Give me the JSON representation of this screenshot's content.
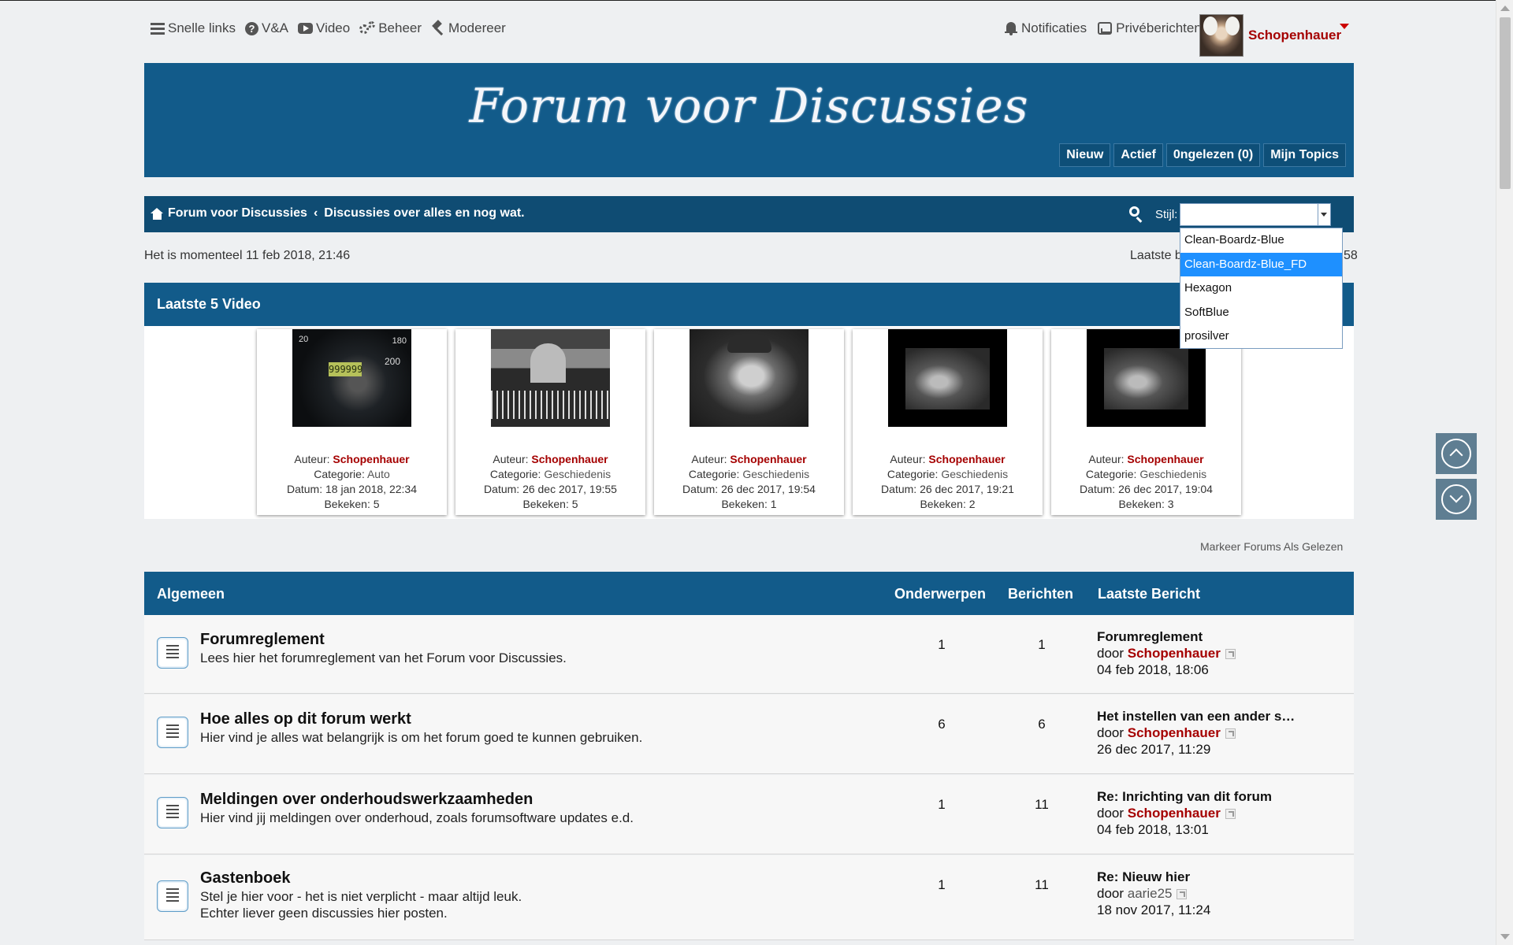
{
  "topnav": [
    {
      "label": "Snelle links",
      "icon": "bars-icon"
    },
    {
      "label": "V&A",
      "icon": "question-icon"
    },
    {
      "label": "Video",
      "icon": "youtube-icon"
    },
    {
      "label": "Beheer",
      "icon": "gears-icon"
    },
    {
      "label": "Modereer",
      "icon": "gavel-icon"
    }
  ],
  "usernav": {
    "notifications": "Notificaties",
    "messages": "Privéberichten",
    "username": "Schopenhauer"
  },
  "banner": {
    "title": "Forum voor Discussies",
    "buttons": [
      "Nieuw",
      "Actief",
      "0ngelezen (0)",
      "Mijn Topics"
    ]
  },
  "breadcrumb": {
    "home": "Forum voor Discussies",
    "separator": "‹",
    "current": "Discussies over alles en nog wat.",
    "style_label": "Stijl:",
    "style_options": [
      "Clean-Boardz-Blue",
      "Clean-Boardz-Blue_FD",
      "Hexagon",
      "SoftBlue",
      "prosilver"
    ],
    "style_selected": "Clean-Boardz-Blue_FD"
  },
  "status": {
    "datetime": "Het is momenteel 11 feb 2018, 21:46",
    "last_visit_partial": "Laatste b",
    "last_visit_tail": "58"
  },
  "videos": {
    "heading": "Laatste 5 Video",
    "labels": {
      "author": "Auteur:",
      "category": "Categorie:",
      "date": "Datum:",
      "views": "Bekeken:"
    },
    "items": [
      {
        "author": "Schopenhauer",
        "category": "Auto",
        "date": "18 jan 2018, 22:34",
        "views": "5"
      },
      {
        "author": "Schopenhauer",
        "category": "Geschiedenis",
        "date": "26 dec 2017, 19:55",
        "views": "5"
      },
      {
        "author": "Schopenhauer",
        "category": "Geschiedenis",
        "date": "26 dec 2017, 19:54",
        "views": "1"
      },
      {
        "author": "Schopenhauer",
        "category": "Geschiedenis",
        "date": "26 dec 2017, 19:21",
        "views": "2"
      },
      {
        "author": "Schopenhauer",
        "category": "Geschiedenis",
        "date": "26 dec 2017, 19:04",
        "views": "3"
      }
    ],
    "speedo_lcd": "999999",
    "speedo_nums": [
      "20",
      "180",
      "200"
    ]
  },
  "mark_read": "Markeer Forums Als Gelezen",
  "forums": {
    "heading": "Algemeen",
    "col_topics": "Onderwerpen",
    "col_posts": "Berichten",
    "col_last": "Laatste Bericht",
    "by": "door",
    "rows": [
      {
        "title": "Forumreglement",
        "desc": "Lees hier het forumreglement van het Forum voor Discussies.",
        "desc2": "",
        "topics": "1",
        "posts": "1",
        "last_title": "Forumreglement",
        "last_user": "Schopenhauer",
        "last_date": "04 feb 2018, 18:06"
      },
      {
        "title": "Hoe alles op dit forum werkt",
        "desc": "Hier vind je alles wat belangrijk is om het forum goed te kunnen gebruiken.",
        "desc2": "",
        "topics": "6",
        "posts": "6",
        "last_title": "Het instellen van een ander s…",
        "last_user": "Schopenhauer",
        "last_date": "26 dec 2017, 11:29"
      },
      {
        "title": "Meldingen over onderhoudswerkzaamheden",
        "desc": "Hier vind jij meldingen over onderhoud, zoals forumsoftware updates e.d.",
        "desc2": "",
        "topics": "1",
        "posts": "11",
        "last_title": "Re: Inrichting van dit forum",
        "last_user": "Schopenhauer",
        "last_date": "04 feb 2018, 13:01"
      },
      {
        "title": "Gastenboek",
        "desc": "Stel je hier voor - het is niet verplicht - maar altijd leuk.",
        "desc2": "Echter liever geen discussies hier posten.",
        "topics": "1",
        "posts": "11",
        "last_title": "Re: Nieuw hier",
        "last_user": "aarie25",
        "last_date": "18 nov 2017, 11:24"
      }
    ]
  }
}
